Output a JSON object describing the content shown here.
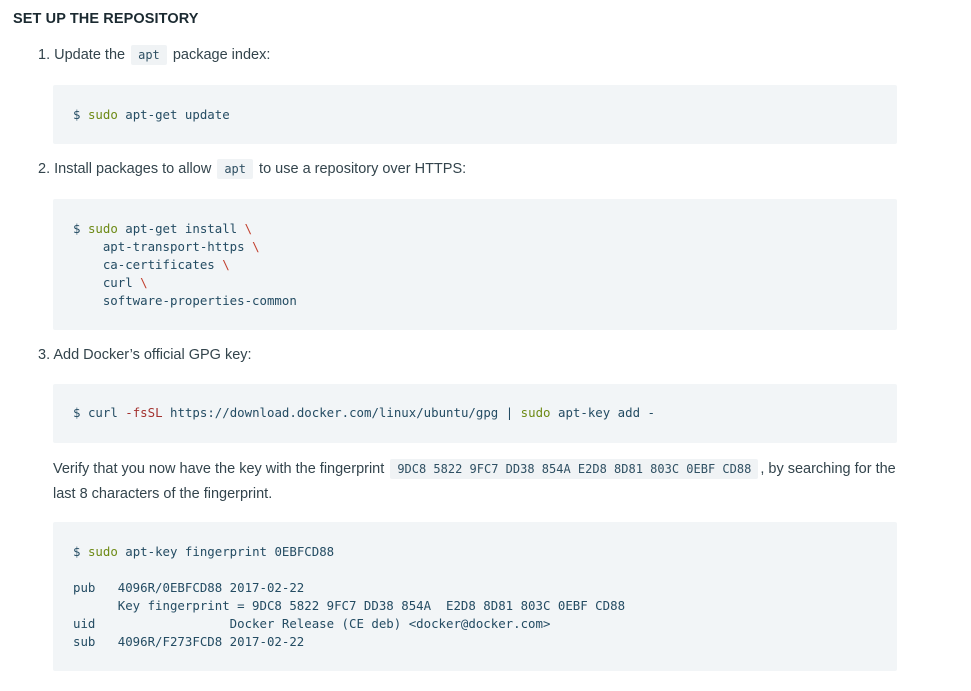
{
  "section_title": "SET UP THE REPOSITORY",
  "steps": [
    {
      "number": "1.",
      "text_before": "Update the",
      "inline_code": "apt",
      "text_after": "package index:",
      "code": {
        "prompt": "$",
        "cmd": "sudo",
        "rest": "apt-get update"
      }
    },
    {
      "number": "2.",
      "text_before": "Install packages to allow",
      "inline_code": "apt",
      "text_after": "to use a repository over HTTPS:",
      "code": {
        "prompt": "$",
        "cmd": "sudo",
        "rest": "apt-get install",
        "continuation": "\\",
        "lines": [
          "apt-transport-https",
          "ca-certificates",
          "curl",
          "software-properties-common"
        ]
      }
    },
    {
      "number": "3.",
      "text": "Add Docker’s official GPG key:",
      "code": {
        "prompt": "$",
        "cmd1": "curl",
        "flag": "-fsSL",
        "url": "https://download.docker.com/linux/ubuntu/gpg",
        "pipe": "|",
        "cmd2": "sudo",
        "rest": "apt-key add -"
      }
    }
  ],
  "verify": {
    "text_before": "Verify that you now have the key with the fingerprint",
    "fingerprint": "9DC8 5822 9FC7 DD38 854A E2D8 8D81 803C 0EBF CD88",
    "text_after": ", by searching for the last 8 characters of the fingerprint."
  },
  "verify_code": {
    "prompt": "$",
    "cmd": "sudo",
    "rest": "apt-key fingerprint 0EBFCD88",
    "output": [
      "pub   4096R/0EBFCD88 2017-02-22",
      "      Key fingerprint = 9DC8 5822 9FC7 DD38 854A  E2D8 8D81 803C 0EBF CD88",
      "uid                  Docker Release (CE deb) <docker@docker.com>",
      "sub   4096R/F273FCD8 2017-02-22"
    ]
  }
}
